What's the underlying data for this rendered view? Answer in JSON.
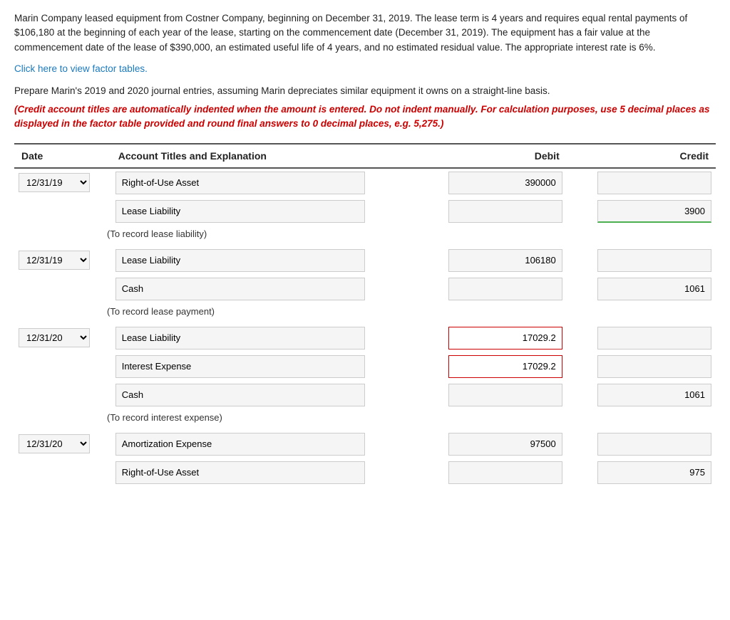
{
  "intro": {
    "text": "Marin Company leased equipment from Costner Company, beginning on December 31, 2019. The lease term is 4 years and requires equal rental payments of $106,180 at the beginning of each year of the lease, starting on the commencement date (December 31, 2019). The equipment has a fair value at the commencement date of the lease of $390,000, an estimated useful life of 4 years, and no estimated residual value. The appropriate interest rate is 6%.",
    "factor_link": "Click here to view factor tables.",
    "prepare_text": "Prepare Marin's 2019 and 2020 journal entries, assuming Marin depreciates similar equipment it owns on a straight-line basis.",
    "credit_notice": "(Credit account titles are automatically indented when the amount is entered. Do not indent manually. For calculation purposes, use 5 decimal places as displayed in the factor table provided and round final answers to 0 decimal places, e.g. 5,275.)"
  },
  "table": {
    "headers": {
      "date": "Date",
      "account": "Account Titles and Explanation",
      "debit": "Debit",
      "credit": "Credit"
    },
    "sections": [
      {
        "id": "section1",
        "date": "12/31/19",
        "rows": [
          {
            "account": "Right-of-Use Asset",
            "debit": "390000",
            "credit": "",
            "debit_highlight": false,
            "credit_highlight": false,
            "debit_green": false,
            "credit_green": false
          },
          {
            "account": "Lease Liability",
            "debit": "",
            "credit": "3900",
            "debit_highlight": false,
            "credit_highlight": false,
            "debit_green": false,
            "credit_green": true,
            "credit_partial": true
          }
        ],
        "note": "(To record lease liability)"
      },
      {
        "id": "section2",
        "date": "12/31/19",
        "rows": [
          {
            "account": "Lease Liability",
            "debit": "106180",
            "credit": "",
            "debit_highlight": false,
            "credit_highlight": false,
            "debit_green": false,
            "credit_green": false
          },
          {
            "account": "Cash",
            "debit": "",
            "credit": "1061",
            "debit_highlight": false,
            "credit_highlight": false,
            "debit_green": false,
            "credit_green": false,
            "credit_partial": true
          }
        ],
        "note": "(To record lease payment)"
      },
      {
        "id": "section3",
        "date": "12/31/20",
        "rows": [
          {
            "account": "Lease Liability",
            "debit": "17029.2",
            "credit": "",
            "debit_highlight": true,
            "credit_highlight": false,
            "debit_green": false,
            "credit_green": false
          },
          {
            "account": "Interest Expense",
            "debit": "17029.2",
            "credit": "",
            "debit_highlight": true,
            "credit_highlight": false,
            "debit_green": false,
            "credit_green": false
          },
          {
            "account": "Cash",
            "debit": "",
            "credit": "1061",
            "debit_highlight": false,
            "credit_highlight": false,
            "debit_green": false,
            "credit_green": false,
            "credit_partial": true
          }
        ],
        "note": "(To record interest expense)"
      },
      {
        "id": "section4",
        "date": "12/31/20",
        "rows": [
          {
            "account": "Amortization Expense",
            "debit": "97500",
            "credit": "",
            "debit_highlight": false,
            "credit_highlight": false,
            "debit_green": false,
            "credit_green": false
          },
          {
            "account": "Right-of-Use Asset",
            "debit": "",
            "credit": "975",
            "debit_highlight": false,
            "credit_highlight": false,
            "debit_green": false,
            "credit_green": false,
            "credit_partial": true
          }
        ],
        "note": ""
      }
    ]
  }
}
